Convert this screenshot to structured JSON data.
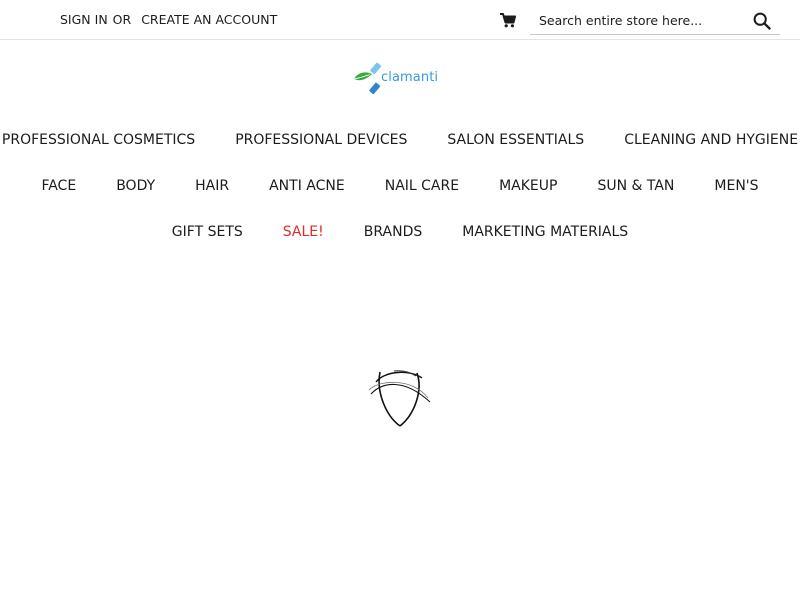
{
  "header": {
    "sign_in": "SIGN IN",
    "or": "OR",
    "create_account": "CREATE AN ACCOUNT",
    "search_placeholder": "Search entire store here..."
  },
  "logo": {
    "text": "clamanti"
  },
  "nav": {
    "row1": [
      "PROFESSIONAL COSMETICS",
      "PROFESSIONAL DEVICES",
      "SALON ESSENTIALS",
      "CLEANING AND HYGIENE"
    ],
    "row2": [
      "FACE",
      "BODY",
      "HAIR",
      "ANTI ACNE",
      "NAIL CARE",
      "MAKEUP",
      "SUN & TAN",
      "MEN'S"
    ],
    "row3": [
      "GIFT SETS",
      "SALE!",
      "BRANDS",
      "MARKETING MATERIALS"
    ]
  },
  "icons": {
    "cart": "cart-icon",
    "search": "search-icon",
    "loader": "loading-spinner-icon"
  },
  "colors": {
    "sale": "#e02b27",
    "logo_blue": "#3a9bd8",
    "logo_green": "#3aa845",
    "text": "#1c1c1c"
  }
}
